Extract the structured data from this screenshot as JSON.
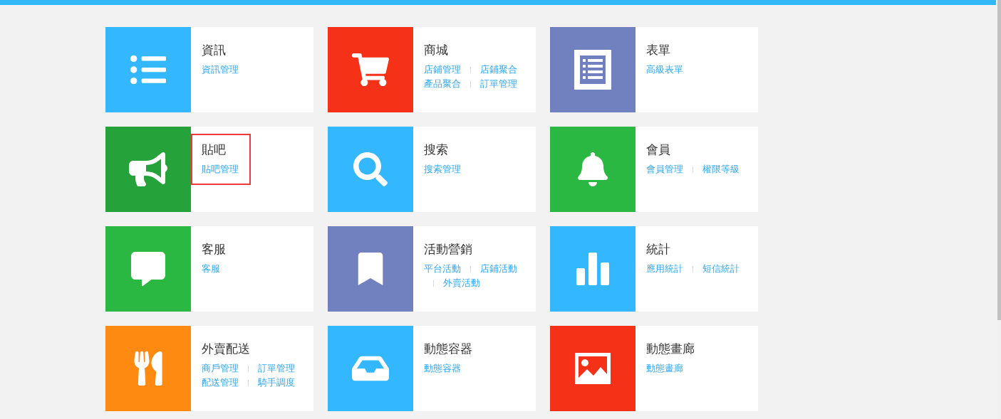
{
  "modules": [
    {
      "title": "資訊",
      "color": "#33b8ff",
      "highlighted": false,
      "link_rows": [
        [
          {
            "label": "資訊管理",
            "divider": false
          }
        ]
      ]
    },
    {
      "title": "商城",
      "color": "#f53118",
      "highlighted": false,
      "link_rows": [
        [
          {
            "label": "店鋪管理",
            "divider": false
          },
          {
            "label": "店鋪聚合",
            "divider": true
          }
        ],
        [
          {
            "label": "產品聚合",
            "divider": false
          },
          {
            "label": "訂單管理",
            "divider": true
          }
        ]
      ]
    },
    {
      "title": "表單",
      "color": "#7181c0",
      "highlighted": false,
      "link_rows": [
        [
          {
            "label": "高級表單",
            "divider": false
          }
        ]
      ]
    },
    {
      "title": "貼吧",
      "color": "#25a23a",
      "highlighted": true,
      "link_rows": [
        [
          {
            "label": "貼吧管理",
            "divider": false
          }
        ]
      ]
    },
    {
      "title": "搜索",
      "color": "#33b8ff",
      "highlighted": false,
      "link_rows": [
        [
          {
            "label": "搜索管理",
            "divider": false
          }
        ]
      ]
    },
    {
      "title": "會員",
      "color": "#2bb842",
      "highlighted": false,
      "link_rows": [
        [
          {
            "label": "會員管理",
            "divider": false
          },
          {
            "label": "權限等級",
            "divider": true
          }
        ]
      ]
    },
    {
      "title": "客服",
      "color": "#2bb842",
      "highlighted": false,
      "link_rows": [
        [
          {
            "label": "客服",
            "divider": false
          }
        ]
      ]
    },
    {
      "title": "活動營銷",
      "color": "#7181c0",
      "highlighted": false,
      "link_rows": [
        [
          {
            "label": "平台活動",
            "divider": false
          },
          {
            "label": "店鋪活動",
            "divider": true
          }
        ],
        [
          {
            "label": "外賣活動",
            "divider": true
          }
        ]
      ]
    },
    {
      "title": "統計",
      "color": "#33b8ff",
      "highlighted": false,
      "link_rows": [
        [
          {
            "label": "應用統計",
            "divider": false
          },
          {
            "label": "短信統計",
            "divider": true
          }
        ]
      ]
    },
    {
      "title": "外賣配送",
      "color": "#ff8a12",
      "highlighted": false,
      "link_rows": [
        [
          {
            "label": "商戶管理",
            "divider": false
          },
          {
            "label": "訂單管理",
            "divider": true
          }
        ],
        [
          {
            "label": "配送管理",
            "divider": false
          },
          {
            "label": "騎手調度",
            "divider": true
          }
        ]
      ]
    },
    {
      "title": "動態容器",
      "color": "#33b8ff",
      "highlighted": false,
      "link_rows": [
        [
          {
            "label": "動態容器",
            "divider": false
          }
        ]
      ]
    },
    {
      "title": "動態畫廊",
      "color": "#f53118",
      "highlighted": false,
      "link_rows": [
        [
          {
            "label": "動態畫廊",
            "divider": false
          }
        ]
      ]
    }
  ]
}
